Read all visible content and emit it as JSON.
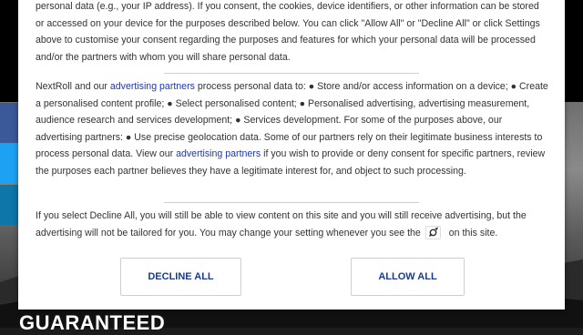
{
  "background": {
    "headline": "GUARANTEED"
  },
  "consent": {
    "p1": "personal data (e.g., your IP address). If you consent, the cookies, device identifiers, or other information can be stored or accessed on your device for the purposes described below. You can click \"Allow All\" or \"Decline All\" or click Settings above to customise your consent regarding the purposes and features for which your personal data will be processed and/or the partners with whom you will share personal data.",
    "p2_a": "NextRoll and our ",
    "p2_link1": "advertising partners",
    "p2_b": " process personal data to: ● Store and/or access information on a device; ● Create a personalised content profile; ● Select personalised content; ● Personalised advertising, advertising measurement, audience research and services development; ● Services development. For some of the purposes above, our advertising partners: ● Use precise geolocation data. Some of our partners rely on their legitimate business interests to process personal data. View our ",
    "p2_link2": "advertising partners",
    "p2_c": " if you wish to provide or deny consent for specific partners, review the purposes each partner believes they have a legitimate interest for, and object to such processing.",
    "p3_a": "If you select Decline All, you will still be able to view content on this site and you will still receive advertising, but the advertising will not be tailored for you. You may change your setting whenever you see the",
    "p3_b": "on this site.",
    "settings_icon": "nextroll-settings-icon",
    "decline_label": "DECLINE ALL",
    "allow_label": "ALLOW ALL"
  },
  "colors": {
    "link": "#1a37b8",
    "button_text": "#1a3a8a",
    "facebook": "#3b5998",
    "twitter": "#1da1f2",
    "linkedin": "#0e76a8"
  }
}
